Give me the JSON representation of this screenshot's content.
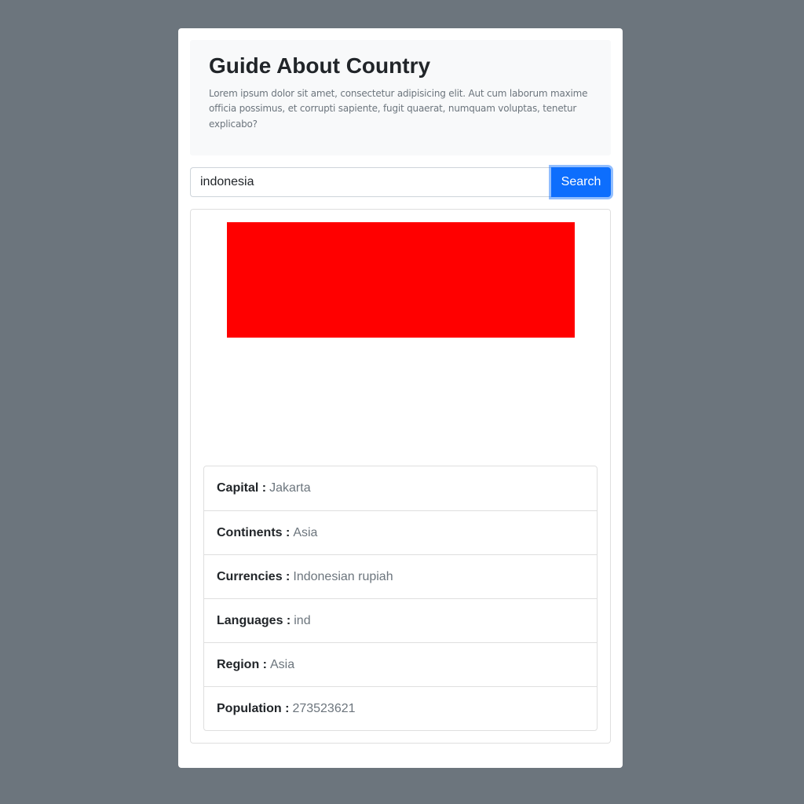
{
  "header": {
    "title": "Guide About Country",
    "description": "Lorem ipsum dolor sit amet, consectetur adipisicing elit. Aut cum laborum maxime officia possimus, et corrupti sapiente, fugit quaerat, numquam voluptas, tenetur explicabo?"
  },
  "search": {
    "value": "indonesia",
    "button_label": "Search"
  },
  "flag": {
    "top_color": "#ff0000",
    "bottom_color": "#ffffff"
  },
  "details": [
    {
      "label": "Capital :",
      "value": "Jakarta"
    },
    {
      "label": "Continents :",
      "value": "Asia"
    },
    {
      "label": "Currencies :",
      "value": "Indonesian rupiah"
    },
    {
      "label": "Languages :",
      "value": "ind"
    },
    {
      "label": "Region :",
      "value": "Asia"
    },
    {
      "label": "Population :",
      "value": "273523621"
    }
  ],
  "colors": {
    "background": "#6c757d",
    "primary": "#0d6efd"
  }
}
